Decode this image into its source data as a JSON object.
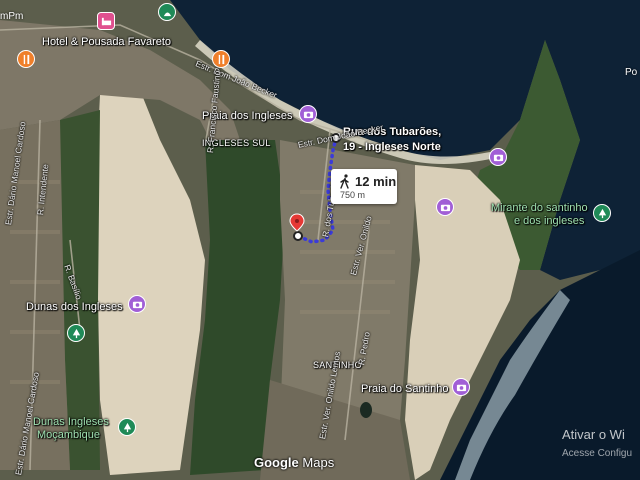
{
  "colors": {
    "ocean": "#0e2236",
    "ocean_deep": "#091a2b",
    "sand": "#d9cfb8",
    "urban": "#7a7566",
    "vegetation": "#2f4a2a",
    "route": "#3b3bd8",
    "marker": "#e53935",
    "surf": "#cfe3ea"
  },
  "top_fragment": "mPm",
  "right_fragment": "Po",
  "places": {
    "hotel": "Hotel & Pousada Favareto",
    "praia_ingleses": "Praia dos Ingleses",
    "ingleses_sul": "INGLESES SUL",
    "destination_line1": "Rua dos Tubarões,",
    "destination_line2": "19 - Ingleses Norte",
    "mirante_line1": "Mirante do santinho",
    "mirante_line2": "e dos ingleses",
    "dunas": "Dunas dos Ingleses",
    "santinho_area": "SANTINHO",
    "praia_santinho": "Praia do Santinho",
    "dunas_mocambique_line1": "Dunas Ingleses",
    "dunas_mocambique_line2": "Moçambique"
  },
  "streets": {
    "estr_dom_joao_becker": "Estr. Dom João Becker",
    "r_dos_tubaroes": "R. dos Tubarões",
    "estr_ver_onildo_lemos": "Estr. Ver. Onildo Lemos",
    "estr_onildo_lemos_upper": "Estr. Ver. Onildo",
    "r_francisco_faustino": "R. Francisco Faustino",
    "estr_dario_manoel_cardoso": "Estr. Dário Manoel Cardoso",
    "r_intendente": "R. Intendente",
    "r_basilio": "R. Basílio",
    "r_pedro": "R. Pedro",
    "estr_dario_cardoso_lower": "Estr. Dário Manoel Cardoso"
  },
  "route": {
    "time": "12 min",
    "distance": "750 m",
    "mode_icon": "walking-icon"
  },
  "attribution": {
    "google": "Google",
    "maps": "Maps"
  },
  "watermark": {
    "line1": "Ativar o Wi",
    "line2": "Acesse Configu"
  }
}
